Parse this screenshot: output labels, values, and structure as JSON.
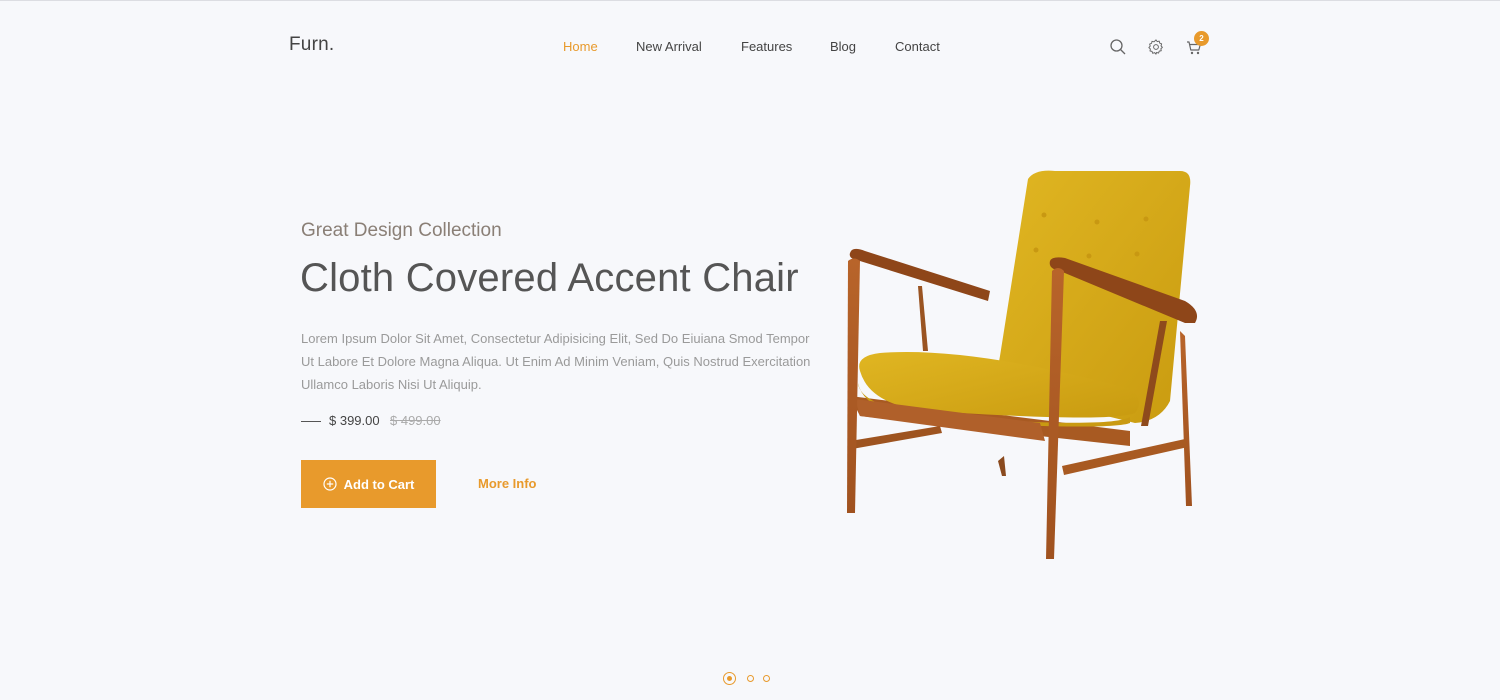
{
  "header": {
    "logo": "Furn.",
    "nav": [
      {
        "label": "Home",
        "active": true
      },
      {
        "label": "New Arrival",
        "active": false
      },
      {
        "label": "Features",
        "active": false
      },
      {
        "label": "Blog",
        "active": false
      },
      {
        "label": "Contact",
        "active": false
      }
    ],
    "icons": [
      "search-icon",
      "gear-icon",
      "cart-icon"
    ],
    "cart_count": "2"
  },
  "hero": {
    "subtitle": "Great Design Collection",
    "title": "Cloth Covered Accent Chair",
    "description": "Lorem Ipsum Dolor Sit Amet, Consectetur Adipisicing Elit, Sed Do Eiuiana Smod Tempor Ut Labore Et Dolore Magna Aliqua. Ut Enim Ad Minim Veniam, Quis Nostrud Exercitation Ullamco Laboris Nisi Ut Aliquip.",
    "price": "$ 399.00",
    "old_price": "$ 499.00",
    "add_to_cart_label": "Add to Cart",
    "more_info_label": "More Info",
    "image_alt": "Yellow cloth covered accent chair with wooden frame"
  },
  "slider": {
    "total_slides": 3,
    "active_slide": 1
  },
  "colors": {
    "accent": "#e89a2c",
    "background": "#f7f8fb",
    "text": "#555555",
    "muted": "#9a9a9a"
  }
}
